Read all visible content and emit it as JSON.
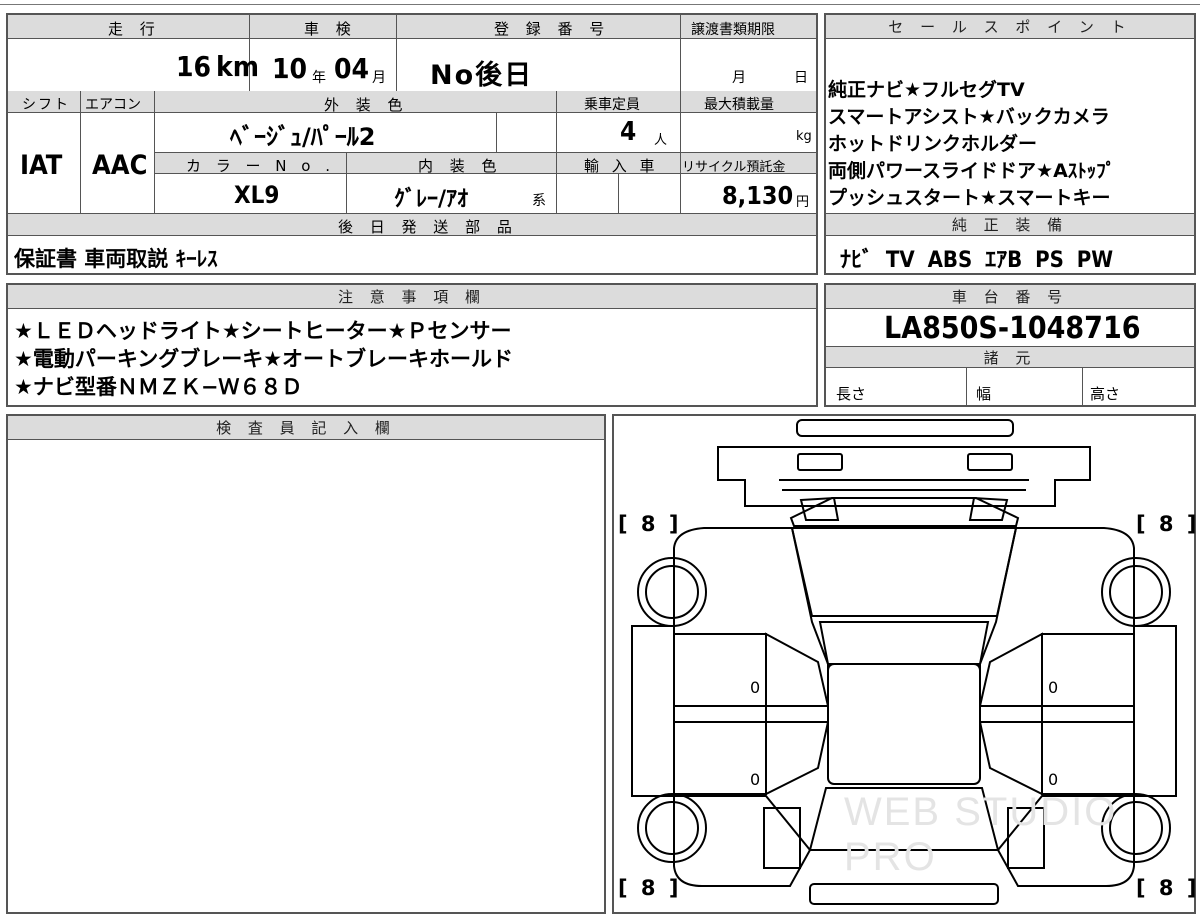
{
  "vehicle_info": {
    "headers": {
      "mileage": "走 行",
      "inspection": "車 検",
      "registration": "登 録 番 号",
      "transfer_deadline": "譲渡書類期限",
      "shift": "シフト",
      "aircon": "エアコン",
      "exterior_color": "外 装 色",
      "capacity": "乗車定員",
      "max_load": "最大積載量",
      "color_no": "カ ラ ー N o .",
      "interior_color": "内 装 色",
      "import": "輸 入 車",
      "recycle": "リサイクル預託金",
      "later_parts": "後 日 発 送 部 品"
    },
    "mileage_value": "16",
    "mileage_unit": "km",
    "inspection_year": "10",
    "inspection_year_unit": "年",
    "inspection_month": "04",
    "inspection_month_unit": "月",
    "registration_value": "No後日",
    "transfer_month_unit": "月",
    "transfer_day_unit": "日",
    "shift_value": "IAT",
    "aircon_value": "AAC",
    "exterior_color_value": "ﾍﾞｰｼﾞｭ/ﾊﾟｰﾙ2",
    "capacity_value": "4",
    "capacity_unit": "人",
    "max_load_unit": "kg",
    "color_no_value": "XL9",
    "interior_color_value": "ｸﾞﾚｰ/ｱｵ",
    "interior_color_suffix": "系",
    "recycle_value": "8,130",
    "recycle_unit": "円",
    "later_parts_value": "保証書 車両取説 ｷｰﾚｽ"
  },
  "sales_points": {
    "header": "セ ー ル ス ポ イ ン ト",
    "lines": [
      "純正ナビ★フルセグTV",
      "スマートアシスト★バックカメラ",
      "ホットドリンクホルダー",
      "両側パワースライドドア★Aｽﾄｯﾌﾟ",
      "プッシュスタート★スマートキー"
    ]
  },
  "factory_equipment": {
    "header": "純 正 装 備",
    "value": "ﾅﾋﾞ TV ABS ｴｱB PS PW"
  },
  "notes": {
    "header": "注 意 事 項 欄",
    "lines": [
      "★ＬＥＤヘッドライト★シートヒーター★Ｐセンサー",
      "★電動パーキングブレーキ★オートブレーキホールド",
      "★ナビ型番ＮＭＺＫ−Ｗ６８Ｄ"
    ]
  },
  "chassis": {
    "header": "車 台 番 号",
    "value": "LA850S-1048716"
  },
  "specs": {
    "header": "諸 元",
    "length_label": "長さ",
    "width_label": "幅",
    "height_label": "高さ"
  },
  "inspector": {
    "header": "検 査 員 記 入 欄"
  },
  "diagram": {
    "tire_front_left": "[ 8 ]",
    "tire_front_right": "[ 8 ]",
    "tire_rear_left": "[ 8 ]",
    "tire_rear_right": "[ 8 ]",
    "door_front_left": "0",
    "door_front_right": "0",
    "door_rear_left": "0",
    "door_rear_right": "0",
    "watermark": "WEB STUDIO PRO"
  }
}
